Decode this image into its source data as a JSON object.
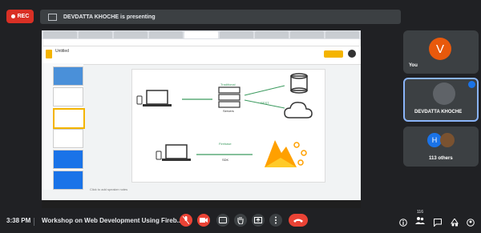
{
  "topbar": {
    "rec_label": "REC",
    "presenting_text": "DEVDATTA KHOCHE is presenting"
  },
  "presentation": {
    "window_title": "Untitled",
    "notes_placeholder": "Click to add speaker notes",
    "diagram": {
      "top_arrow_label": "Traditional",
      "top_arrow2_label": "REST",
      "server_label": "Servers",
      "bottom_label": "Firebase",
      "bottom_arrow_label": "SDK"
    }
  },
  "participants": {
    "self": {
      "initial": "V",
      "label": "You",
      "avatar_color": "#e8590c"
    },
    "presenter": {
      "label": "DEVDATTA KHOCHE"
    },
    "others": {
      "initial": "H",
      "label": "113 others",
      "avatar_color": "#1a73e8"
    }
  },
  "bottombar": {
    "time": "3:38 PM",
    "meeting_title": "Workshop on Web Development Using Fireb...",
    "participants_badge": "116"
  }
}
